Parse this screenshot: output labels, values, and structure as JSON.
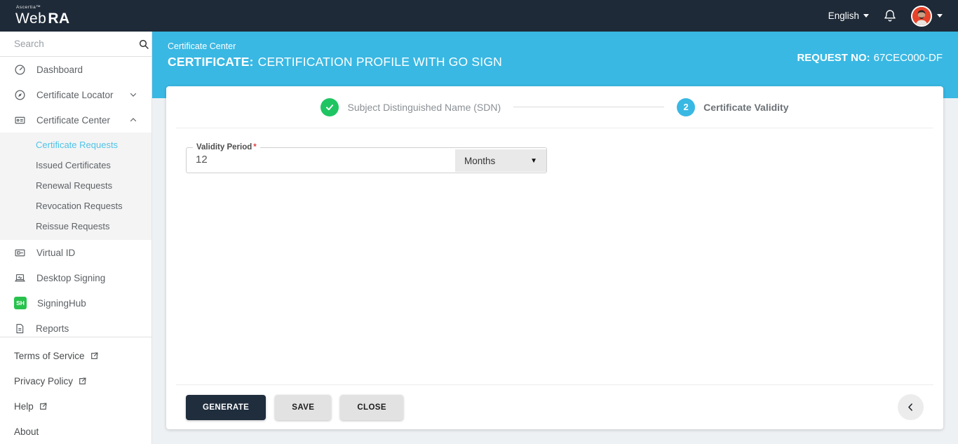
{
  "topbar": {
    "brand_company": "Ascertia™",
    "brand_product_web": "Web",
    "brand_product_ra": "RA",
    "language": "English"
  },
  "sidebar": {
    "search_placeholder": "Search",
    "items": [
      {
        "label": "Dashboard",
        "icon": "dashboard-gauge"
      },
      {
        "label": "Certificate Locator",
        "icon": "compass",
        "chevron": "down"
      },
      {
        "label": "Certificate Center",
        "icon": "badge-card",
        "chevron": "up",
        "children": [
          "Certificate Requests",
          "Issued Certificates",
          "Renewal Requests",
          "Revocation Requests",
          "Reissue Requests"
        ],
        "active_child": "Certificate Requests"
      },
      {
        "label": "Virtual ID",
        "icon": "id-card"
      },
      {
        "label": "Desktop Signing",
        "icon": "laptop-sign"
      },
      {
        "label": "SigningHub",
        "icon": "sh-badge",
        "badge_text": "SH"
      },
      {
        "label": "Reports",
        "icon": "document"
      }
    ],
    "footer_links": [
      {
        "label": "Terms of Service",
        "external": true
      },
      {
        "label": "Privacy Policy",
        "external": true
      },
      {
        "label": "Help",
        "external": true
      },
      {
        "label": "About",
        "external": false
      }
    ]
  },
  "header": {
    "breadcrumb": "Certificate Center",
    "title_prefix": "CERTIFICATE:",
    "title": "CERTIFICATION PROFILE WITH GO SIGN",
    "request_label": "REQUEST NO:",
    "request_value": "67CEC000-DF"
  },
  "stepper": {
    "steps": [
      {
        "label": "Subject Distinguished Name (SDN)",
        "state": "complete"
      },
      {
        "label": "Certificate Validity",
        "state": "active",
        "number": "2"
      }
    ]
  },
  "form": {
    "validity_label": "Validity Period",
    "required_marker": "*",
    "validity_value": "12",
    "unit_selected": "Months",
    "unit_caret": "▼"
  },
  "actions": {
    "generate": "GENERATE",
    "save": "SAVE",
    "close": "CLOSE"
  },
  "colors": {
    "topbar_bg": "#1e2a38",
    "accent_cyan": "#39b8e3",
    "active_link": "#4fc3e8",
    "success_green": "#1fc562",
    "signinghub_green": "#27c24c",
    "primary_button": "#1f2d3d"
  }
}
